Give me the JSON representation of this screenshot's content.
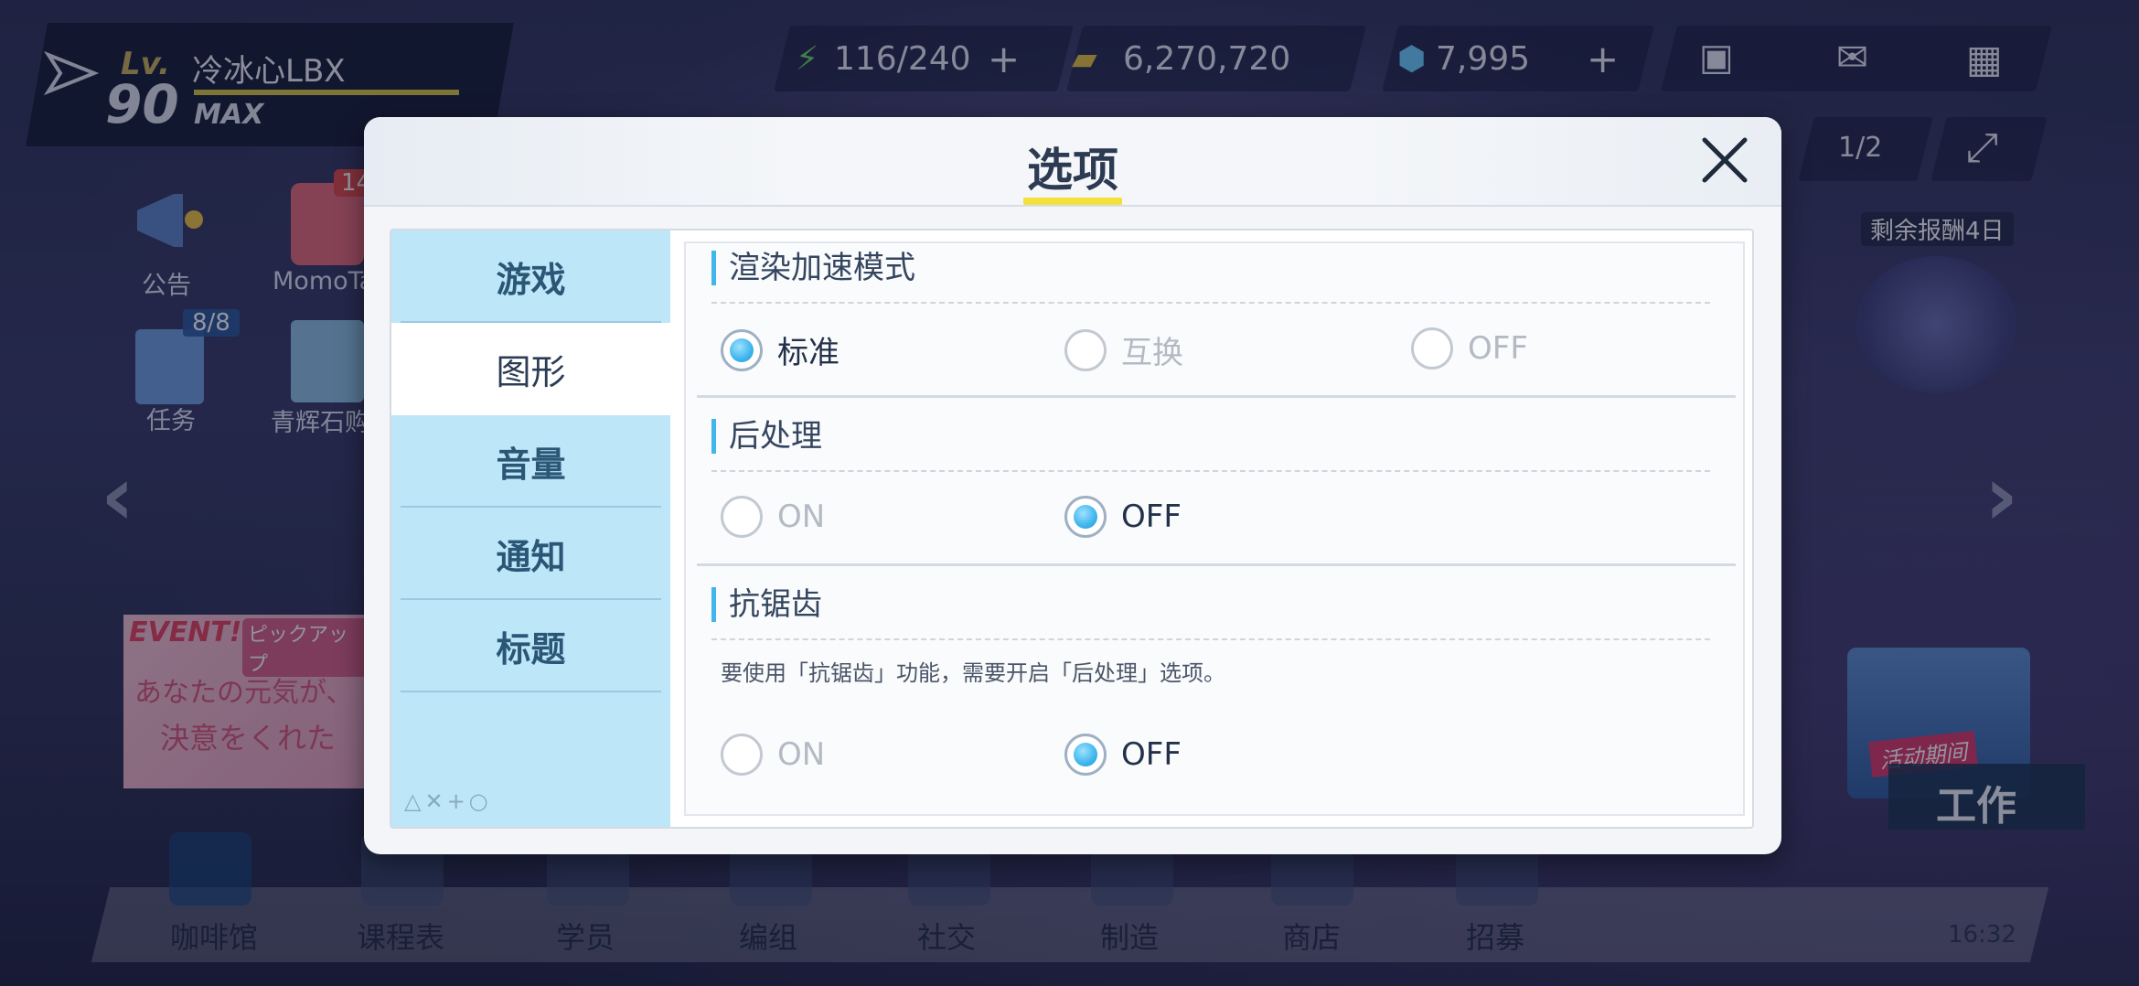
{
  "hud": {
    "level_label": "Lv.",
    "level": "90",
    "player_name": "冷冰心LBX",
    "max_label": "MAX",
    "ap": "116/240",
    "credits": "6,270,720",
    "gems": "7,995",
    "page_indicator": "1/2",
    "reward_days": "剩余报酬4日"
  },
  "side_menu": {
    "notice": "公告",
    "momotalk": "MomoTa",
    "momotalk_badge": "14",
    "mission": "任务",
    "mission_badge": "8/8",
    "shop_item": "青辉石购"
  },
  "event_banner": {
    "tag": "EVENT!",
    "subtitle": "ピックアップ",
    "text_line1": "あなたの元気が、",
    "text_line2": "決意をくれた"
  },
  "work_button": "工作",
  "event_tag": "活动期间",
  "bottom_nav": [
    "咖啡馆",
    "课程表",
    "学员",
    "编组",
    "社交",
    "制造",
    "商店",
    "招募"
  ],
  "clock": "16:32",
  "dialog": {
    "title": "选项",
    "tabs": [
      "游戏",
      "图形",
      "音量",
      "通知",
      "标题"
    ],
    "active_tab": "图形",
    "tab_deco": "△✕+○",
    "sections": {
      "render": {
        "title": "渲染加速模式",
        "options": [
          "标准",
          "互换",
          "OFF"
        ],
        "selected": "标准"
      },
      "post": {
        "title": "后处理",
        "options": [
          "ON",
          "OFF"
        ],
        "selected": "OFF"
      },
      "aa": {
        "title": "抗锯齿",
        "note": "要使用「抗锯齿」功能，需要开启「后处理」选项。",
        "options": [
          "ON",
          "OFF"
        ],
        "selected": "OFF"
      }
    }
  },
  "colors": {
    "accent_blue": "#42b6ea",
    "tab_bg": "#bde6f8",
    "title_underline": "#f4e03a"
  }
}
